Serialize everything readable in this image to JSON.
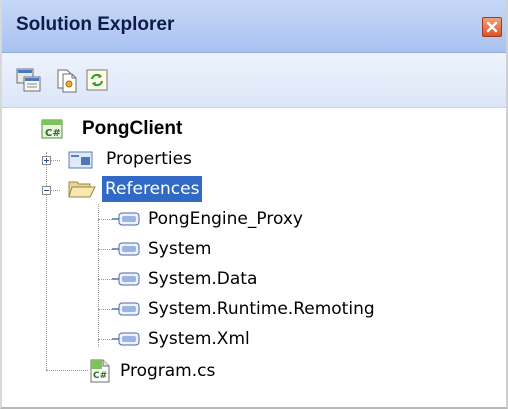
{
  "panel": {
    "title": "Solution Explorer",
    "close_icon": "close-icon"
  },
  "toolbar": {
    "buttons": [
      {
        "name": "properties-button",
        "icon": "properties-icon"
      },
      {
        "name": "show-all-files-button",
        "icon": "show-all-files-icon"
      },
      {
        "name": "refresh-button",
        "icon": "refresh-icon"
      }
    ]
  },
  "tree": {
    "project": {
      "label": "PongClient",
      "icon": "csharp-project-icon"
    },
    "properties": {
      "label": "Properties",
      "icon": "properties-folder-icon",
      "expander": "+"
    },
    "references": {
      "label": "References",
      "icon": "folder-open-icon",
      "expander": "-",
      "selected": true,
      "items": [
        "PongEngine_Proxy",
        "System",
        "System.Data",
        "System.Runtime.Remoting",
        "System.Xml"
      ]
    },
    "program": {
      "label": "Program.cs",
      "icon": "csharp-file-icon"
    }
  },
  "colors": {
    "title_bar": "#b7cdf4",
    "selection": "#316ac5",
    "close_button": "#d9542c"
  }
}
